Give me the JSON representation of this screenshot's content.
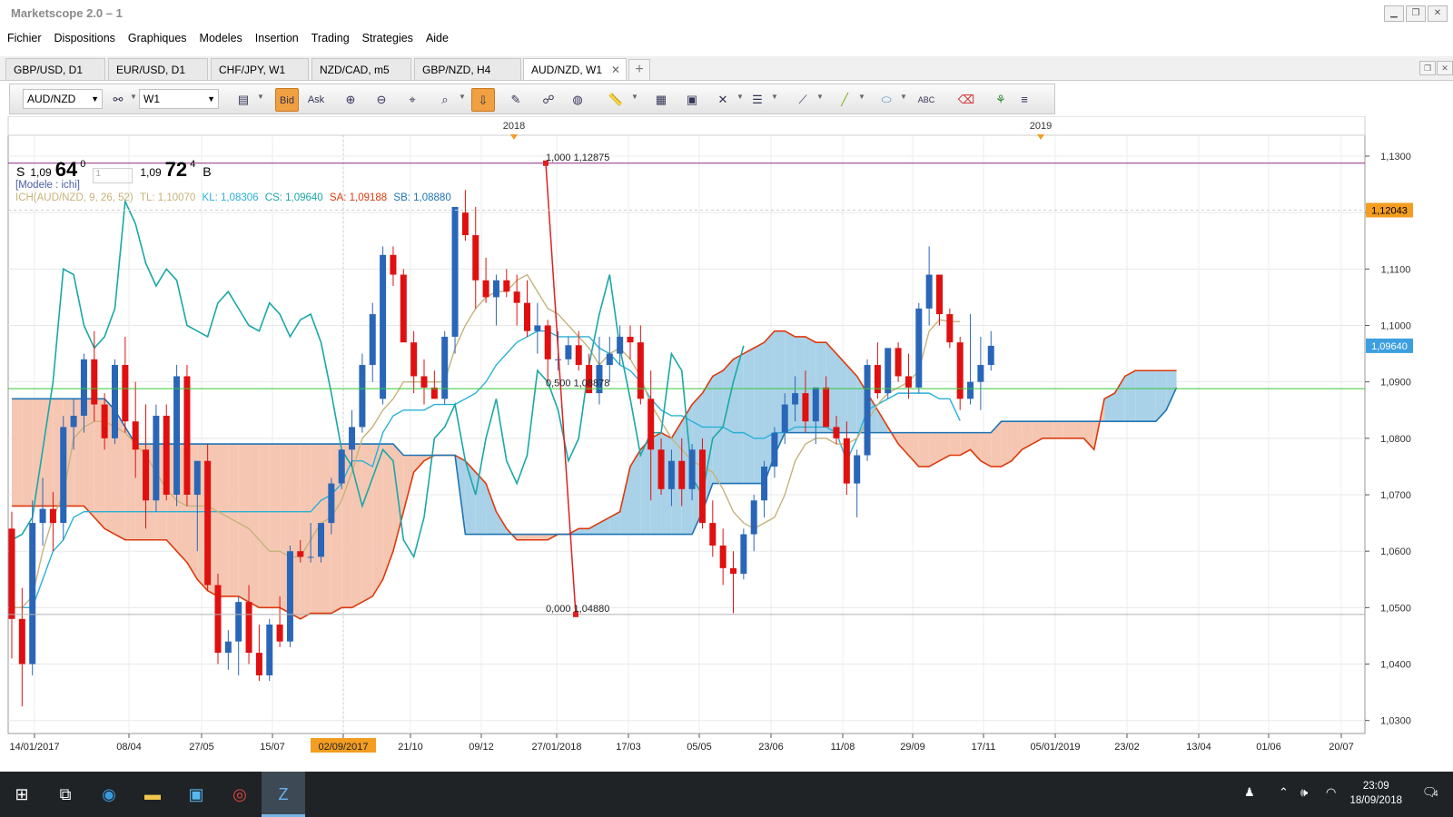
{
  "window": {
    "title": "Marketscope 2.0 – 1"
  },
  "menu": [
    "Fichier",
    "Dispositions",
    "Graphiques",
    "Modeles",
    "Insertion",
    "Trading",
    "Strategies",
    "Aide"
  ],
  "tabs": [
    {
      "label": "GBP/USD, D1",
      "active": false
    },
    {
      "label": "EUR/USD, D1",
      "active": false
    },
    {
      "label": "CHF/JPY, W1",
      "active": false
    },
    {
      "label": "NZD/CAD, m5",
      "active": false
    },
    {
      "label": "GBP/NZD, H4",
      "active": false
    },
    {
      "label": "AUD/NZD, W1",
      "active": true
    }
  ],
  "toolbar": {
    "symbol": "AUD/NZD",
    "timeframe": "W1",
    "bid_label": "Bid",
    "ask_label": "Ask"
  },
  "quote": {
    "sell_label": "S",
    "sell_prefix": "1,09",
    "sell_big": "64",
    "sell_sup": "0",
    "lots": "1",
    "buy_prefix": "1,09",
    "buy_big": "72",
    "buy_sup": "4",
    "buy_label": "B"
  },
  "legend": {
    "model": "[Modele : ichi]",
    "ich": "ICH(AUD/NZD, 9, 26, 52)",
    "tl": "TL: 1,10070",
    "kl": "KL: 1,08306",
    "cs": "CS: 1,09640",
    "sa": "SA: 1,09188",
    "sb": "SB: 1,08880"
  },
  "colors": {
    "bull": "#2a66b8",
    "bear": "#e01010",
    "tenkan": "#c6b27a",
    "kijun": "#2ab0d8",
    "chikou": "#1aa7a7",
    "spanA": "#dd3a0c",
    "spanB": "#1e74b4",
    "cloudBull": "#a9d2e8",
    "cloudBear": "#f5c7b3",
    "fib": "#e02020",
    "hline": "#8f2a8a",
    "gline": "#39c839",
    "priceTag": "#f39d21",
    "lastTag": "#3d9fe0"
  },
  "chart_data": {
    "type": "candlestick",
    "title": "AUD/NZD, W1",
    "x_labels": [
      "14/01/2017",
      "08/04",
      "27/05",
      "15/07",
      "02/09/2017",
      "21/10",
      "09/12",
      "27/01/2018",
      "17/03",
      "05/05",
      "23/06",
      "11/08",
      "29/09",
      "17/11",
      "05/01/2019",
      "23/02",
      "13/04",
      "01/06",
      "20/07"
    ],
    "year_markers": [
      "2018",
      "2019"
    ],
    "y_ticks": [
      "1,1300",
      "1,1200",
      "1,1100",
      "1,1000",
      "1,0900",
      "1,0800",
      "1,0700",
      "1,0600",
      "1,0500",
      "1,0400",
      "1,0300"
    ],
    "ylim": [
      1.0277,
      1.1337
    ],
    "price_tags": {
      "current": "1,12043",
      "last": "1,09640"
    },
    "fibonacci": [
      {
        "level": "1,000",
        "price": "1,12875",
        "value": 1.12875
      },
      {
        "level": "0,500",
        "price": "1,08878",
        "value": 1.08878
      },
      {
        "level": "0,000",
        "price": "1,04880",
        "value": 1.0488
      }
    ],
    "hlines": [
      {
        "value": 1.12875,
        "color": "#8f2a8a"
      },
      {
        "value": 1.0888,
        "color": "#39c839"
      },
      {
        "value": 1.0488,
        "color": "#b0b0b0"
      }
    ],
    "candles": [
      [
        1.064,
        1.067,
        1.041,
        1.048
      ],
      [
        1.048,
        1.0535,
        1.0325,
        1.04
      ],
      [
        1.04,
        1.069,
        1.038,
        1.065
      ],
      [
        1.065,
        1.073,
        1.061,
        1.0675
      ],
      [
        1.0675,
        1.0705,
        1.06,
        1.065
      ],
      [
        1.065,
        1.084,
        1.062,
        1.082
      ],
      [
        1.082,
        1.087,
        1.078,
        1.084
      ],
      [
        1.084,
        1.095,
        1.081,
        1.094
      ],
      [
        1.094,
        1.099,
        1.083,
        1.086
      ],
      [
        1.086,
        1.088,
        1.078,
        1.08
      ],
      [
        1.08,
        1.094,
        1.079,
        1.093
      ],
      [
        1.093,
        1.098,
        1.081,
        1.083
      ],
      [
        1.083,
        1.09,
        1.073,
        1.078
      ],
      [
        1.078,
        1.086,
        1.064,
        1.069
      ],
      [
        1.069,
        1.086,
        1.067,
        1.084
      ],
      [
        1.084,
        1.086,
        1.069,
        1.07
      ],
      [
        1.07,
        1.093,
        1.068,
        1.091
      ],
      [
        1.091,
        1.093,
        1.068,
        1.07
      ],
      [
        1.07,
        1.076,
        1.06,
        1.076
      ],
      [
        1.076,
        1.079,
        1.053,
        1.054
      ],
      [
        1.054,
        1.056,
        1.04,
        1.042
      ],
      [
        1.042,
        1.046,
        1.039,
        1.044
      ],
      [
        1.044,
        1.052,
        1.038,
        1.051
      ],
      [
        1.051,
        1.054,
        1.04,
        1.042
      ],
      [
        1.042,
        1.047,
        1.037,
        1.038
      ],
      [
        1.038,
        1.048,
        1.037,
        1.047
      ],
      [
        1.047,
        1.052,
        1.043,
        1.044
      ],
      [
        1.044,
        1.061,
        1.043,
        1.06
      ],
      [
        1.06,
        1.062,
        1.058,
        1.059
      ],
      [
        1.059,
        1.065,
        1.058,
        1.059
      ],
      [
        1.059,
        1.065,
        1.058,
        1.065
      ],
      [
        1.065,
        1.073,
        1.063,
        1.072
      ],
      [
        1.072,
        1.078,
        1.071,
        1.078
      ],
      [
        1.078,
        1.085,
        1.075,
        1.082
      ],
      [
        1.082,
        1.095,
        1.081,
        1.093
      ],
      [
        1.093,
        1.104,
        1.09,
        1.102
      ],
      [
        1.087,
        1.114,
        1.086,
        1.1125
      ],
      [
        1.1125,
        1.114,
        1.107,
        1.109
      ],
      [
        1.109,
        1.11,
        1.099,
        1.097
      ],
      [
        1.097,
        1.099,
        1.088,
        1.091
      ],
      [
        1.091,
        1.094,
        1.086,
        1.089
      ],
      [
        1.089,
        1.092,
        1.087,
        1.087
      ],
      [
        1.087,
        1.099,
        1.086,
        1.098
      ],
      [
        1.098,
        1.121,
        1.095,
        1.121
      ],
      [
        1.12,
        1.124,
        1.115,
        1.116
      ],
      [
        1.116,
        1.121,
        1.103,
        1.108
      ],
      [
        1.108,
        1.112,
        1.104,
        1.105
      ],
      [
        1.105,
        1.109,
        1.1,
        1.108
      ],
      [
        1.108,
        1.11,
        1.105,
        1.106
      ],
      [
        1.106,
        1.109,
        1.1,
        1.104
      ],
      [
        1.104,
        1.108,
        1.098,
        1.099
      ],
      [
        1.099,
        1.104,
        1.095,
        1.1
      ],
      [
        1.1,
        1.101,
        1.09,
        1.094
      ],
      [
        1.094,
        1.099,
        1.092,
        1.094
      ],
      [
        1.094,
        1.098,
        1.093,
        1.0965
      ],
      [
        1.0965,
        1.099,
        1.092,
        1.093
      ],
      [
        1.093,
        1.095,
        1.088,
        1.088
      ],
      [
        1.088,
        1.098,
        1.086,
        1.093
      ],
      [
        1.093,
        1.098,
        1.09,
        1.095
      ],
      [
        1.095,
        1.1,
        1.093,
        1.098
      ],
      [
        1.098,
        1.1,
        1.094,
        1.097
      ],
      [
        1.097,
        1.1,
        1.086,
        1.087
      ],
      [
        1.087,
        1.092,
        1.069,
        1.078
      ],
      [
        1.078,
        1.08,
        1.07,
        1.071
      ],
      [
        1.071,
        1.078,
        1.068,
        1.076
      ],
      [
        1.076,
        1.08,
        1.068,
        1.071
      ],
      [
        1.071,
        1.079,
        1.069,
        1.078
      ],
      [
        1.078,
        1.08,
        1.064,
        1.065
      ],
      [
        1.065,
        1.069,
        1.059,
        1.061
      ],
      [
        1.061,
        1.064,
        1.054,
        1.057
      ],
      [
        1.057,
        1.06,
        1.049,
        1.056
      ],
      [
        1.056,
        1.064,
        1.055,
        1.063
      ],
      [
        1.063,
        1.07,
        1.06,
        1.069
      ],
      [
        1.069,
        1.076,
        1.066,
        1.075
      ],
      [
        1.075,
        1.082,
        1.073,
        1.081
      ],
      [
        1.081,
        1.088,
        1.079,
        1.086
      ],
      [
        1.086,
        1.091,
        1.083,
        1.088
      ],
      [
        1.088,
        1.092,
        1.081,
        1.083
      ],
      [
        1.083,
        1.089,
        1.079,
        1.089
      ],
      [
        1.089,
        1.091,
        1.082,
        1.082
      ],
      [
        1.082,
        1.084,
        1.079,
        1.08
      ],
      [
        1.08,
        1.083,
        1.07,
        1.072
      ],
      [
        1.072,
        1.078,
        1.066,
        1.077
      ],
      [
        1.077,
        1.094,
        1.076,
        1.093
      ],
      [
        1.093,
        1.097,
        1.087,
        1.088
      ],
      [
        1.088,
        1.096,
        1.087,
        1.096
      ],
      [
        1.096,
        1.097,
        1.09,
        1.091
      ],
      [
        1.091,
        1.095,
        1.087,
        1.089
      ],
      [
        1.089,
        1.104,
        1.088,
        1.103
      ],
      [
        1.103,
        1.114,
        1.1,
        1.109
      ],
      [
        1.109,
        1.109,
        1.1,
        1.102
      ],
      [
        1.102,
        1.103,
        1.096,
        1.097
      ],
      [
        1.097,
        1.098,
        1.085,
        1.087
      ],
      [
        1.087,
        1.102,
        1.086,
        1.09
      ],
      [
        1.09,
        1.098,
        1.085,
        1.093
      ],
      [
        1.093,
        1.099,
        1.092,
        1.0964
      ]
    ],
    "tenkan": [
      1.05,
      1.05,
      1.052,
      1.06,
      1.066,
      1.07,
      1.08,
      1.082,
      1.083,
      1.083,
      1.082,
      1.081,
      1.079,
      1.077,
      1.074,
      1.071,
      1.069,
      1.068,
      1.068,
      1.068,
      1.067,
      1.066,
      1.065,
      1.064,
      1.062,
      1.06,
      1.06,
      1.059,
      1.059,
      1.062,
      1.065,
      1.066,
      1.069,
      1.074,
      1.08,
      1.082,
      1.085,
      1.087,
      1.09,
      1.09,
      1.09,
      1.09,
      1.09,
      1.096,
      1.1,
      1.103,
      1.105,
      1.106,
      1.106,
      1.108,
      1.109,
      1.106,
      1.103,
      1.102,
      1.1,
      1.098,
      1.096,
      1.093,
      1.095,
      1.096,
      1.094,
      1.091,
      1.086,
      1.083,
      1.08,
      1.078,
      1.076,
      1.075,
      1.074,
      1.071,
      1.067,
      1.065,
      1.064,
      1.065,
      1.066,
      1.07,
      1.076,
      1.079,
      1.08,
      1.08,
      1.079,
      1.079,
      1.08,
      1.083,
      1.086,
      1.088,
      1.089,
      1.09,
      1.092,
      1.099,
      1.101,
      1.1007,
      1.1007
    ],
    "kijun": [
      1.05,
      1.05,
      1.05,
      1.055,
      1.06,
      1.062,
      1.066,
      1.067,
      1.067,
      1.067,
      1.067,
      1.067,
      1.067,
      1.067,
      1.067,
      1.067,
      1.067,
      1.067,
      1.067,
      1.067,
      1.067,
      1.067,
      1.067,
      1.067,
      1.067,
      1.067,
      1.067,
      1.067,
      1.067,
      1.067,
      1.069,
      1.07,
      1.072,
      1.076,
      1.076,
      1.075,
      1.081,
      1.084,
      1.085,
      1.085,
      1.085,
      1.086,
      1.086,
      1.086,
      1.087,
      1.088,
      1.09,
      1.093,
      1.095,
      1.097,
      1.098,
      1.099,
      1.099,
      1.098,
      1.098,
      1.098,
      1.098,
      1.096,
      1.095,
      1.093,
      1.092,
      1.09,
      1.087,
      1.085,
      1.084,
      1.084,
      1.083,
      1.082,
      1.082,
      1.082,
      1.081,
      1.081,
      1.08,
      1.08,
      1.081,
      1.081,
      1.082,
      1.082,
      1.082,
      1.082,
      1.081,
      1.076,
      1.08,
      1.085,
      1.086,
      1.087,
      1.088,
      1.088,
      1.088,
      1.088,
      1.087,
      1.087,
      1.0831
    ],
    "chikou": [
      1.062,
      1.063,
      1.066,
      1.078,
      1.09,
      1.11,
      1.109,
      1.1,
      1.096,
      1.098,
      1.103,
      1.122,
      1.118,
      1.111,
      1.107,
      1.11,
      1.108,
      1.1,
      1.099,
      1.098,
      1.104,
      1.106,
      1.103,
      1.1,
      1.099,
      1.104,
      1.102,
      1.098,
      1.101,
      1.102,
      1.097,
      1.088,
      1.078,
      1.075,
      1.068,
      1.073,
      1.078,
      1.076,
      1.062,
      1.059,
      1.066,
      1.08,
      1.082,
      1.086,
      1.076,
      1.07,
      1.08,
      1.087,
      1.076,
      1.072,
      1.077,
      1.092,
      1.09,
      1.085,
      1.076,
      1.08,
      1.093,
      1.102,
      1.109,
      1.096,
      1.087,
      1.077,
      1.081,
      1.081,
      1.095,
      1.092,
      1.073,
      1.07,
      1.08,
      1.082,
      1.09,
      1.0964
    ],
    "span_a": [
      1.068,
      1.068,
      1.068,
      1.068,
      1.068,
      1.068,
      1.068,
      1.068,
      1.066,
      1.064,
      1.063,
      1.062,
      1.062,
      1.062,
      1.062,
      1.062,
      1.06,
      1.058,
      1.055,
      1.053,
      1.052,
      1.052,
      1.052,
      1.051,
      1.05,
      1.05,
      1.05,
      1.049,
      1.048,
      1.049,
      1.049,
      1.049,
      1.05,
      1.05,
      1.051,
      1.052,
      1.055,
      1.06,
      1.067,
      1.074,
      1.076,
      1.077,
      1.077,
      1.077,
      1.076,
      1.074,
      1.072,
      1.067,
      1.064,
      1.062,
      1.062,
      1.062,
      1.062,
      1.063,
      1.063,
      1.064,
      1.064,
      1.065,
      1.066,
      1.067,
      1.075,
      1.078,
      1.08,
      1.081,
      1.08,
      1.083,
      1.086,
      1.088,
      1.091,
      1.092,
      1.094,
      1.095,
      1.096,
      1.097,
      1.099,
      1.099,
      1.098,
      1.098,
      1.097,
      1.097,
      1.095,
      1.093,
      1.091,
      1.088,
      1.085,
      1.082,
      1.079,
      1.077,
      1.075,
      1.075,
      1.076,
      1.077,
      1.077,
      1.078,
      1.076,
      1.075,
      1.075,
      1.076,
      1.078,
      1.079,
      1.08,
      1.08,
      1.08,
      1.08,
      1.08,
      1.078,
      1.087,
      1.088,
      1.091,
      1.092,
      1.092,
      1.092,
      1.092,
      1.092
    ],
    "span_b": [
      1.087,
      1.087,
      1.087,
      1.087,
      1.087,
      1.087,
      1.087,
      1.087,
      1.087,
      1.087,
      1.085,
      1.082,
      1.079,
      1.079,
      1.079,
      1.079,
      1.079,
      1.079,
      1.079,
      1.079,
      1.079,
      1.079,
      1.079,
      1.079,
      1.079,
      1.079,
      1.079,
      1.079,
      1.079,
      1.079,
      1.079,
      1.079,
      1.079,
      1.079,
      1.079,
      1.079,
      1.079,
      1.079,
      1.077,
      1.077,
      1.077,
      1.077,
      1.077,
      1.077,
      1.063,
      1.063,
      1.063,
      1.063,
      1.063,
      1.063,
      1.063,
      1.063,
      1.063,
      1.063,
      1.063,
      1.063,
      1.063,
      1.063,
      1.063,
      1.063,
      1.063,
      1.063,
      1.063,
      1.063,
      1.063,
      1.063,
      1.063,
      1.067,
      1.072,
      1.072,
      1.072,
      1.072,
      1.072,
      1.072,
      1.077,
      1.081,
      1.081,
      1.081,
      1.081,
      1.081,
      1.081,
      1.081,
      1.081,
      1.081,
      1.081,
      1.081,
      1.081,
      1.081,
      1.081,
      1.081,
      1.081,
      1.081,
      1.081,
      1.081,
      1.081,
      1.081,
      1.083,
      1.083,
      1.083,
      1.083,
      1.083,
      1.083,
      1.083,
      1.083,
      1.083,
      1.083,
      1.083,
      1.083,
      1.083,
      1.083,
      1.083,
      1.083,
      1.085,
      1.089,
      1.089,
      1.089,
      1.089,
      1.089,
      1.089,
      1.089,
      1.089,
      1.089,
      1.089,
      1.089,
      1.089,
      1.089,
      1.089
    ]
  },
  "taskbar": {
    "time": "23:09",
    "date": "18/09/2018",
    "notifications": "4"
  }
}
